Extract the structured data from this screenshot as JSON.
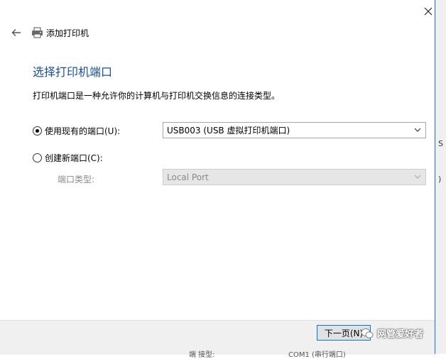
{
  "window": {
    "title": "添加打印机"
  },
  "page": {
    "heading": "选择打印机端口",
    "description": "打印机端口是一种允许你的计算机与打印机交换信息的连接类型。"
  },
  "options": {
    "existing_port": {
      "label": "使用现有的端口(U):",
      "selected": true,
      "value": "USB003 (USB 虚拟打印机端口)"
    },
    "new_port": {
      "label": "创建新端口(C):",
      "selected": false,
      "port_type_label": "端口类型:",
      "port_type_value": "Local Port"
    }
  },
  "footer": {
    "next_label": "下一页(N)"
  },
  "watermark": {
    "text": "网管爱好者"
  },
  "background_fragments": {
    "side_s": "S",
    "side_bracket": ")",
    "bottom_label": "端  接型:",
    "bottom_value": "COM1 (串行端口)"
  },
  "icons": {
    "close": "close-icon",
    "back": "back-arrow-icon",
    "printer": "printer-icon",
    "chevron": "chevron-down-icon"
  },
  "colors": {
    "heading": "#1a4c9c",
    "accent": "#0078d7",
    "footer_bg": "#f0f0f0",
    "disabled_text": "#8a8a8a"
  }
}
